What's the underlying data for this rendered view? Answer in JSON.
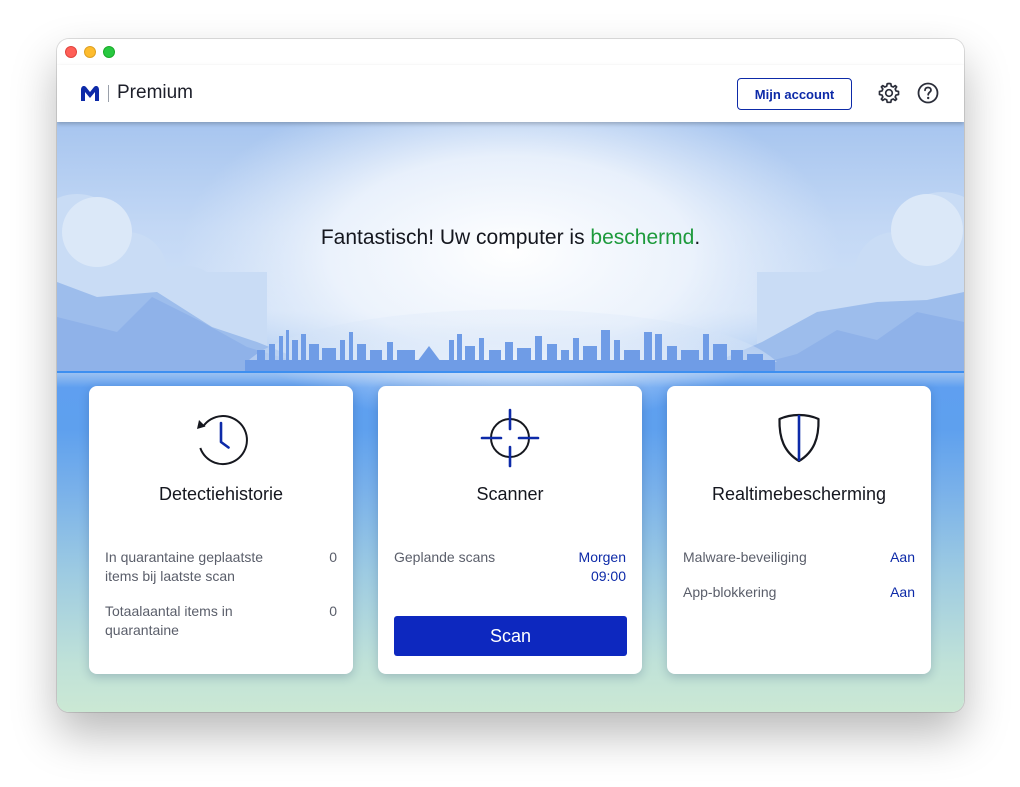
{
  "colors": {
    "brand_blue": "#0d2aa8",
    "scan_button": "#0d28bf",
    "protected_green": "#1d9a3c"
  },
  "header": {
    "logo_icon": "malwarebytes-logo-icon",
    "product": "Premium",
    "account_button": "Mijn account",
    "settings_icon": "gear-icon",
    "help_icon": "help-circle-icon"
  },
  "hero": {
    "title_prefix": "Fantastisch! Uw computer is ",
    "title_status": "beschermd",
    "title_suffix": "."
  },
  "cards": [
    {
      "title": "Detectiehistorie",
      "icon": "history-clock-icon",
      "rows": [
        {
          "label": "In quarantaine geplaatste items bij laatste scan",
          "value": "0"
        },
        {
          "label": "Totaalaantal items in quarantaine",
          "value": "0"
        }
      ]
    },
    {
      "title": "Scanner",
      "icon": "crosshair-icon",
      "rows": [
        {
          "label": "Geplande scans",
          "value": "Morgen 09:00"
        }
      ],
      "button": "Scan"
    },
    {
      "title": "Realtimebescherming",
      "icon": "shield-icon",
      "rows": [
        {
          "label": "Malware-beveiliging",
          "value": "Aan"
        },
        {
          "label": "App-blokkering",
          "value": "Aan"
        }
      ]
    }
  ]
}
